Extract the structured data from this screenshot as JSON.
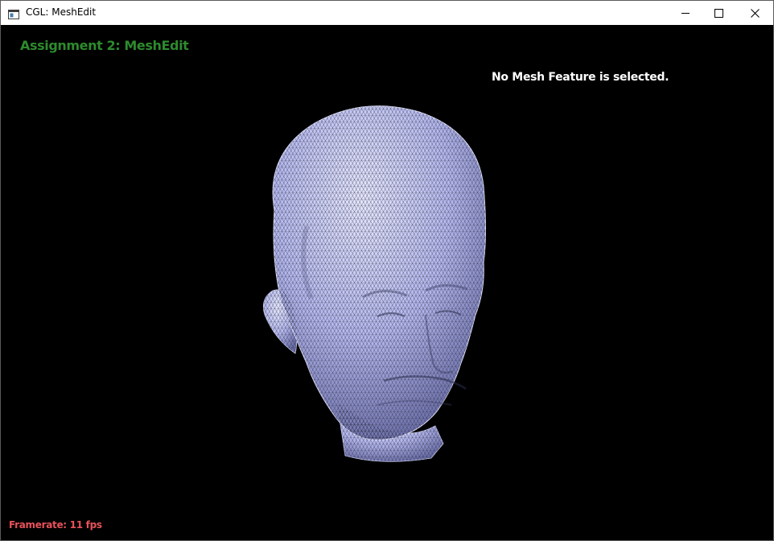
{
  "window": {
    "title": "CGL: MeshEdit",
    "app_icon": "application-window-icon",
    "controls": {
      "minimize_icon": "minimize-icon",
      "maximize_icon": "maximize-icon",
      "close_icon": "close-icon"
    }
  },
  "viewer": {
    "heading": "Assignment 2: MeshEdit",
    "selection_status": "No Mesh Feature is selected.",
    "framerate_label": "Framerate:",
    "framerate_value": "11 fps",
    "mesh": "head-mesh"
  },
  "colors": {
    "background": "#000000",
    "heading": "#2d8a2d",
    "status_text": "#ffffff",
    "framerate": "#e8515a",
    "mesh_fill": "#b4b8ee",
    "mesh_wire": "#2a2a3a"
  }
}
